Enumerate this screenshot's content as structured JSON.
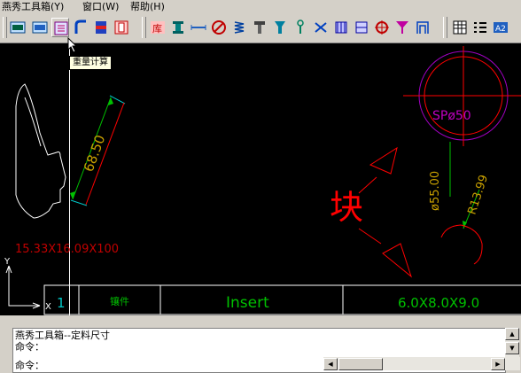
{
  "menubar": {
    "items": [
      {
        "label": "燕秀工具箱(Y)"
      },
      {
        "label": "窗口(W)"
      },
      {
        "label": "帮助(H)"
      }
    ]
  },
  "toolbar": {
    "buttons": [
      "weight-calc-a-icon",
      "weight-calc-b-icon",
      "weight-calc-c-icon",
      "bend-pipe-icon",
      "plate-icon",
      "frame-icon",
      "library-icon",
      "standard-part-icon",
      "dimension-icon",
      "target-icon",
      "spring-icon",
      "screw-icon",
      "bolt-icon",
      "pin-icon",
      "hinge-icon",
      "bearing-icon",
      "crosshair-icon",
      "funnel-icon",
      "mold-icon",
      "table-icon",
      "list-icon",
      "a2-icon"
    ]
  },
  "tooltip": {
    "text": "重量计算"
  },
  "drawing": {
    "text_block_size": "15.33X16.09X100",
    "dim_6850": "68.50",
    "dim_sp50": "SPø50",
    "dim_55": "ø55.00",
    "dim_r13": "R13.99",
    "label_block": "块",
    "table": {
      "col1": "1",
      "col2": "镶件",
      "col3": "Insert",
      "col4": "6.0X8.0X9.0"
    },
    "axis_y": "Y",
    "axis_x": "X"
  },
  "command": {
    "lines": [
      "燕秀工具箱--定料尺寸",
      "命令：",
      "命令："
    ]
  },
  "colors": {
    "canvas_bg": "#000000",
    "crosshair": "#ffffff",
    "red": "#ff0000",
    "yellow": "#c8a000",
    "magenta": "#c000c0",
    "green": "#00c000",
    "cyan": "#00c8c8",
    "ui_face": "#d4d0c8"
  }
}
